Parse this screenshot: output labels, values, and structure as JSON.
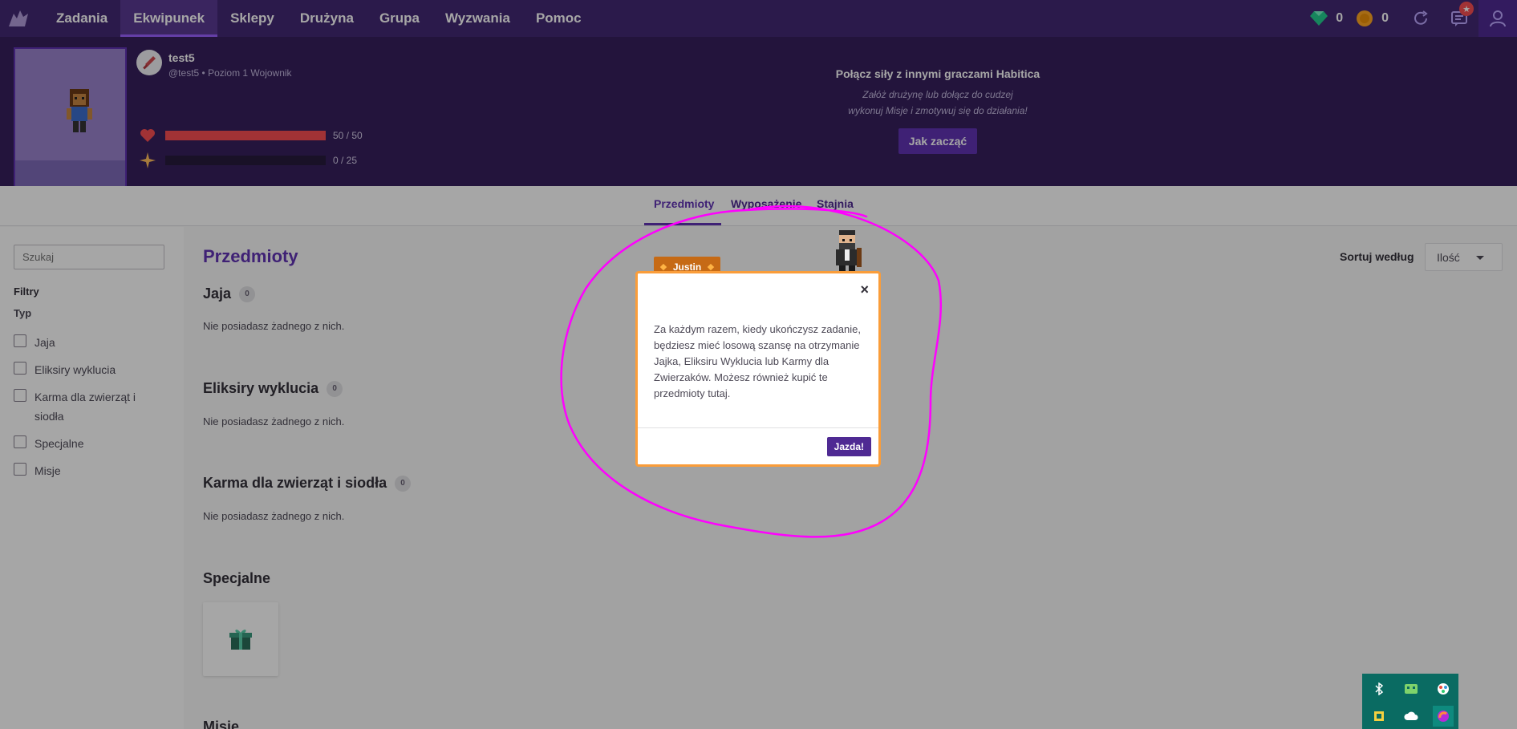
{
  "nav": {
    "items": [
      "Zadania",
      "Ekwipunek",
      "Sklepy",
      "Drużyna",
      "Grupa",
      "Wyzwania",
      "Pomoc"
    ],
    "active": "Ekwipunek",
    "gems": "0",
    "gold": "0",
    "notification_badge": "★"
  },
  "user": {
    "name": "test5",
    "subtitle": "@test5 • Poziom 1 Wojownik",
    "health": {
      "current": 50,
      "max": 50,
      "label": "50 / 50"
    },
    "experience": {
      "current": 0,
      "max": 25,
      "label": "0 / 25"
    }
  },
  "party": {
    "title": "Połącz siły z innymi graczami Habitica",
    "desc_line1": "Załóż drużynę lub dołącz do cudzej",
    "desc_line2": "wykonuj Misje i zmotywuj się do działania!",
    "button": "Jak zacząć"
  },
  "tabs": {
    "items": [
      "Przedmioty",
      "Wyposażenie",
      "Stajnia"
    ],
    "active": "Przedmioty"
  },
  "sidebar": {
    "search_placeholder": "Szukaj",
    "filters_label": "Filtry",
    "type_label": "Typ",
    "types": [
      "Jaja",
      "Eliksiry wyklucia",
      "Karma dla zwierząt i siodła",
      "Specjalne",
      "Misje"
    ]
  },
  "main": {
    "title": "Przedmioty",
    "sort_label": "Sortuj według",
    "sort_value": "Ilość",
    "sections": [
      {
        "title": "Jaja",
        "count": "0",
        "empty": "Nie posiadasz żadnego z nich."
      },
      {
        "title": "Eliksiry wyklucia",
        "count": "0",
        "empty": "Nie posiadasz żadnego z nich."
      },
      {
        "title": "Karma dla zwierząt i siodła",
        "count": "0",
        "empty": "Nie posiadasz żadnego z nich."
      },
      {
        "title": "Specjalne"
      }
    ],
    "partial_section": "Misje"
  },
  "tour": {
    "npc_name": "Justin",
    "text": "Za każdym razem, kiedy ukończysz zadanie, będziesz mieć losową szansę na otrzymanie Jajka, Eliksiru Wyklucia lub Karmy dla Zwierzaków. Możesz również kupić te przedmioty tutaj.",
    "close": "×",
    "button": "Jazda!"
  },
  "colors": {
    "nav_bg": "#432874",
    "header_bg": "#36205d",
    "accent": "#6133b4",
    "health": "#f74e52",
    "modal_border": "#fa9d3a",
    "annotation": "#ff00ff"
  }
}
